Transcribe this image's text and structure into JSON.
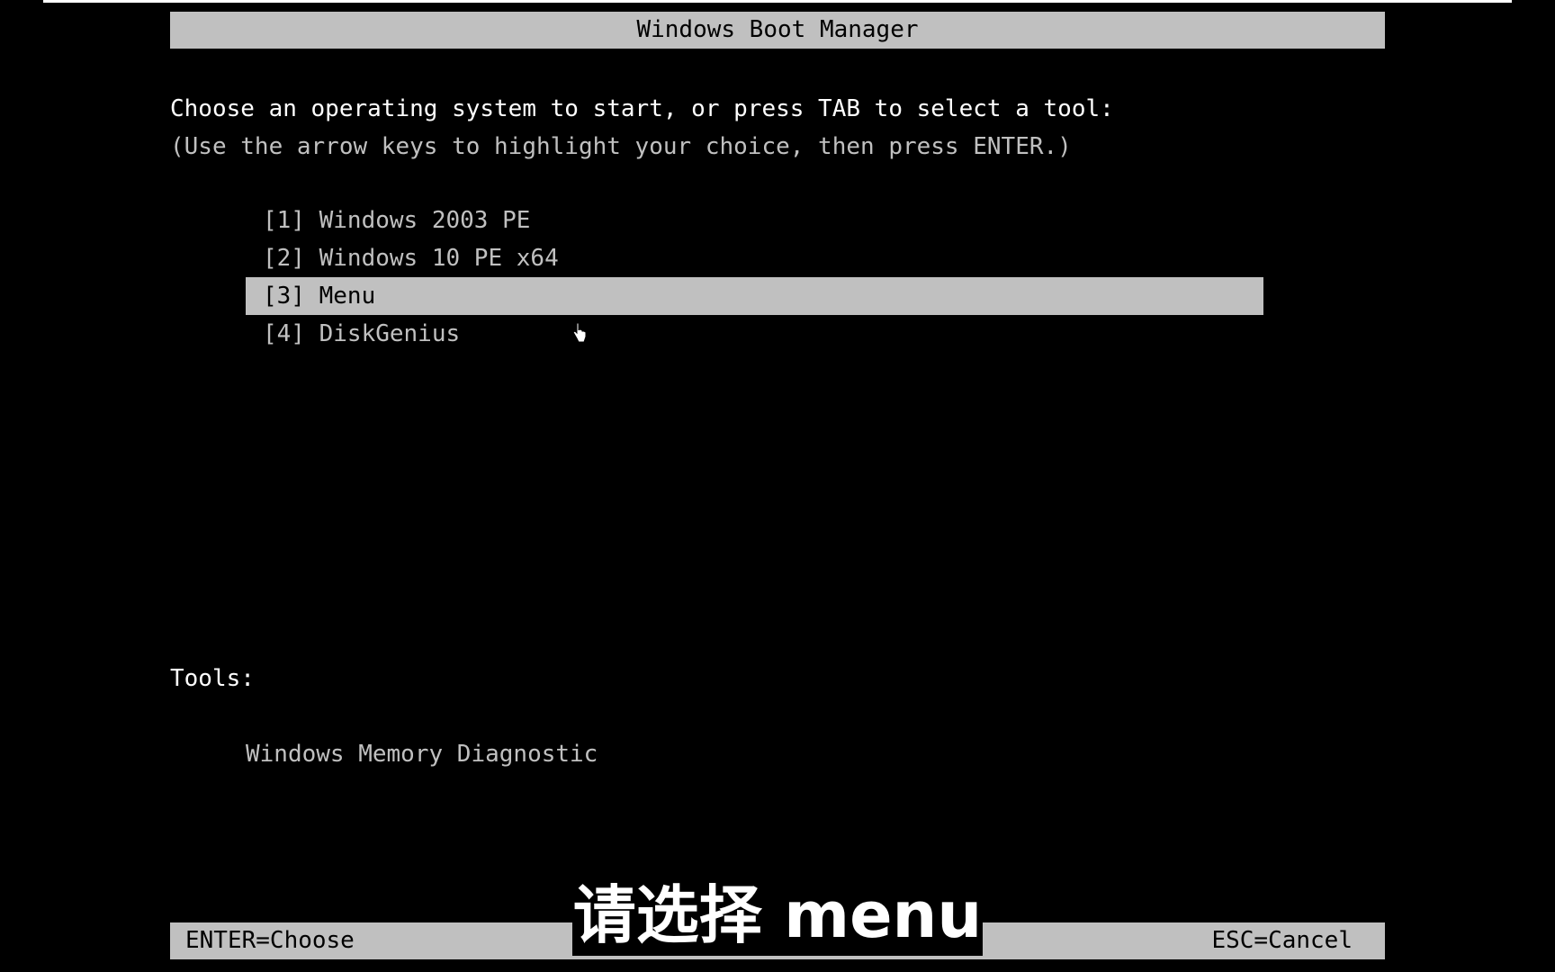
{
  "window": {
    "title": "Windows Boot Manager"
  },
  "prompt": {
    "line1": "Choose an operating system to start, or press TAB to select a tool:",
    "line2": "(Use the arrow keys to highlight your choice, then press ENTER.)"
  },
  "os_entries": [
    {
      "label": "[1] Windows 2003 PE",
      "selected": false
    },
    {
      "label": "[2] Windows 10 PE x64",
      "selected": false
    },
    {
      "label": "[3] Menu",
      "selected": true
    },
    {
      "label": "[4] DiskGenius",
      "selected": false
    }
  ],
  "tools": {
    "label": "Tools:",
    "items": [
      "Windows Memory Diagnostic"
    ]
  },
  "footer": {
    "left": "ENTER=Choose",
    "right": "ESC=Cancel"
  },
  "subtitle": {
    "text": "请选择 menu"
  },
  "colors": {
    "background": "#000000",
    "bar": "#c0c0c0",
    "text": "#c0c0c0",
    "text_bright": "#ffffff"
  },
  "icons": {
    "cursor": "hand-pointer-icon"
  }
}
